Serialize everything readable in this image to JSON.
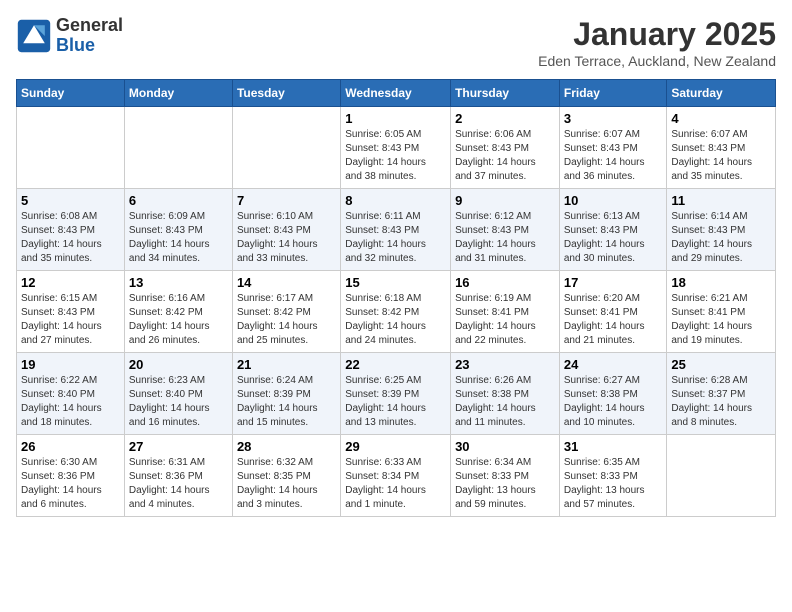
{
  "header": {
    "logo_general": "General",
    "logo_blue": "Blue",
    "month_title": "January 2025",
    "location": "Eden Terrace, Auckland, New Zealand"
  },
  "days_of_week": [
    "Sunday",
    "Monday",
    "Tuesday",
    "Wednesday",
    "Thursday",
    "Friday",
    "Saturday"
  ],
  "weeks": [
    [
      {
        "day": "",
        "info": ""
      },
      {
        "day": "",
        "info": ""
      },
      {
        "day": "",
        "info": ""
      },
      {
        "day": "1",
        "info": "Sunrise: 6:05 AM\nSunset: 8:43 PM\nDaylight: 14 hours\nand 38 minutes."
      },
      {
        "day": "2",
        "info": "Sunrise: 6:06 AM\nSunset: 8:43 PM\nDaylight: 14 hours\nand 37 minutes."
      },
      {
        "day": "3",
        "info": "Sunrise: 6:07 AM\nSunset: 8:43 PM\nDaylight: 14 hours\nand 36 minutes."
      },
      {
        "day": "4",
        "info": "Sunrise: 6:07 AM\nSunset: 8:43 PM\nDaylight: 14 hours\nand 35 minutes."
      }
    ],
    [
      {
        "day": "5",
        "info": "Sunrise: 6:08 AM\nSunset: 8:43 PM\nDaylight: 14 hours\nand 35 minutes."
      },
      {
        "day": "6",
        "info": "Sunrise: 6:09 AM\nSunset: 8:43 PM\nDaylight: 14 hours\nand 34 minutes."
      },
      {
        "day": "7",
        "info": "Sunrise: 6:10 AM\nSunset: 8:43 PM\nDaylight: 14 hours\nand 33 minutes."
      },
      {
        "day": "8",
        "info": "Sunrise: 6:11 AM\nSunset: 8:43 PM\nDaylight: 14 hours\nand 32 minutes."
      },
      {
        "day": "9",
        "info": "Sunrise: 6:12 AM\nSunset: 8:43 PM\nDaylight: 14 hours\nand 31 minutes."
      },
      {
        "day": "10",
        "info": "Sunrise: 6:13 AM\nSunset: 8:43 PM\nDaylight: 14 hours\nand 30 minutes."
      },
      {
        "day": "11",
        "info": "Sunrise: 6:14 AM\nSunset: 8:43 PM\nDaylight: 14 hours\nand 29 minutes."
      }
    ],
    [
      {
        "day": "12",
        "info": "Sunrise: 6:15 AM\nSunset: 8:43 PM\nDaylight: 14 hours\nand 27 minutes."
      },
      {
        "day": "13",
        "info": "Sunrise: 6:16 AM\nSunset: 8:42 PM\nDaylight: 14 hours\nand 26 minutes."
      },
      {
        "day": "14",
        "info": "Sunrise: 6:17 AM\nSunset: 8:42 PM\nDaylight: 14 hours\nand 25 minutes."
      },
      {
        "day": "15",
        "info": "Sunrise: 6:18 AM\nSunset: 8:42 PM\nDaylight: 14 hours\nand 24 minutes."
      },
      {
        "day": "16",
        "info": "Sunrise: 6:19 AM\nSunset: 8:41 PM\nDaylight: 14 hours\nand 22 minutes."
      },
      {
        "day": "17",
        "info": "Sunrise: 6:20 AM\nSunset: 8:41 PM\nDaylight: 14 hours\nand 21 minutes."
      },
      {
        "day": "18",
        "info": "Sunrise: 6:21 AM\nSunset: 8:41 PM\nDaylight: 14 hours\nand 19 minutes."
      }
    ],
    [
      {
        "day": "19",
        "info": "Sunrise: 6:22 AM\nSunset: 8:40 PM\nDaylight: 14 hours\nand 18 minutes."
      },
      {
        "day": "20",
        "info": "Sunrise: 6:23 AM\nSunset: 8:40 PM\nDaylight: 14 hours\nand 16 minutes."
      },
      {
        "day": "21",
        "info": "Sunrise: 6:24 AM\nSunset: 8:39 PM\nDaylight: 14 hours\nand 15 minutes."
      },
      {
        "day": "22",
        "info": "Sunrise: 6:25 AM\nSunset: 8:39 PM\nDaylight: 14 hours\nand 13 minutes."
      },
      {
        "day": "23",
        "info": "Sunrise: 6:26 AM\nSunset: 8:38 PM\nDaylight: 14 hours\nand 11 minutes."
      },
      {
        "day": "24",
        "info": "Sunrise: 6:27 AM\nSunset: 8:38 PM\nDaylight: 14 hours\nand 10 minutes."
      },
      {
        "day": "25",
        "info": "Sunrise: 6:28 AM\nSunset: 8:37 PM\nDaylight: 14 hours\nand 8 minutes."
      }
    ],
    [
      {
        "day": "26",
        "info": "Sunrise: 6:30 AM\nSunset: 8:36 PM\nDaylight: 14 hours\nand 6 minutes."
      },
      {
        "day": "27",
        "info": "Sunrise: 6:31 AM\nSunset: 8:36 PM\nDaylight: 14 hours\nand 4 minutes."
      },
      {
        "day": "28",
        "info": "Sunrise: 6:32 AM\nSunset: 8:35 PM\nDaylight: 14 hours\nand 3 minutes."
      },
      {
        "day": "29",
        "info": "Sunrise: 6:33 AM\nSunset: 8:34 PM\nDaylight: 14 hours\nand 1 minute."
      },
      {
        "day": "30",
        "info": "Sunrise: 6:34 AM\nSunset: 8:33 PM\nDaylight: 13 hours\nand 59 minutes."
      },
      {
        "day": "31",
        "info": "Sunrise: 6:35 AM\nSunset: 8:33 PM\nDaylight: 13 hours\nand 57 minutes."
      },
      {
        "day": "",
        "info": ""
      }
    ]
  ]
}
